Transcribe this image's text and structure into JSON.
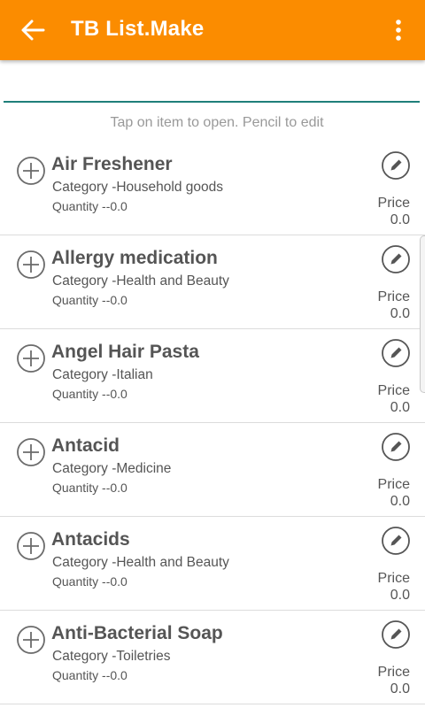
{
  "app_bar": {
    "title": "TB List.Make",
    "back_icon": "arrow-left-icon",
    "menu_icon": "more-vert-icon",
    "color": "#fb8c00"
  },
  "search": {
    "value": "",
    "underline_color": "#1f7f7a"
  },
  "hint": "Tap on item to open. Pencil to edit",
  "items": [
    {
      "name": "Air Freshener",
      "category": "Category -Household goods",
      "quantity": "Quantity --0.0",
      "price_label": "Price",
      "price": "0.0"
    },
    {
      "name": "Allergy medication",
      "category": "Category -Health and Beauty",
      "quantity": "Quantity --0.0",
      "price_label": "Price",
      "price": "0.0"
    },
    {
      "name": "Angel Hair Pasta",
      "category": "Category -Italian",
      "quantity": "Quantity --0.0",
      "price_label": "Price",
      "price": "0.0"
    },
    {
      "name": "Antacid",
      "category": "Category -Medicine",
      "quantity": "Quantity --0.0",
      "price_label": "Price",
      "price": "0.0"
    },
    {
      "name": "Antacids",
      "category": "Category -Health and Beauty",
      "quantity": "Quantity --0.0",
      "price_label": "Price",
      "price": "0.0"
    },
    {
      "name": "Anti-Bacterial Soap",
      "category": "Category -Toiletries",
      "quantity": "Quantity --0.0",
      "price_label": "Price",
      "price": "0.0"
    }
  ],
  "item_icons": {
    "add": "add-circle-icon",
    "edit": "pencil-icon"
  }
}
